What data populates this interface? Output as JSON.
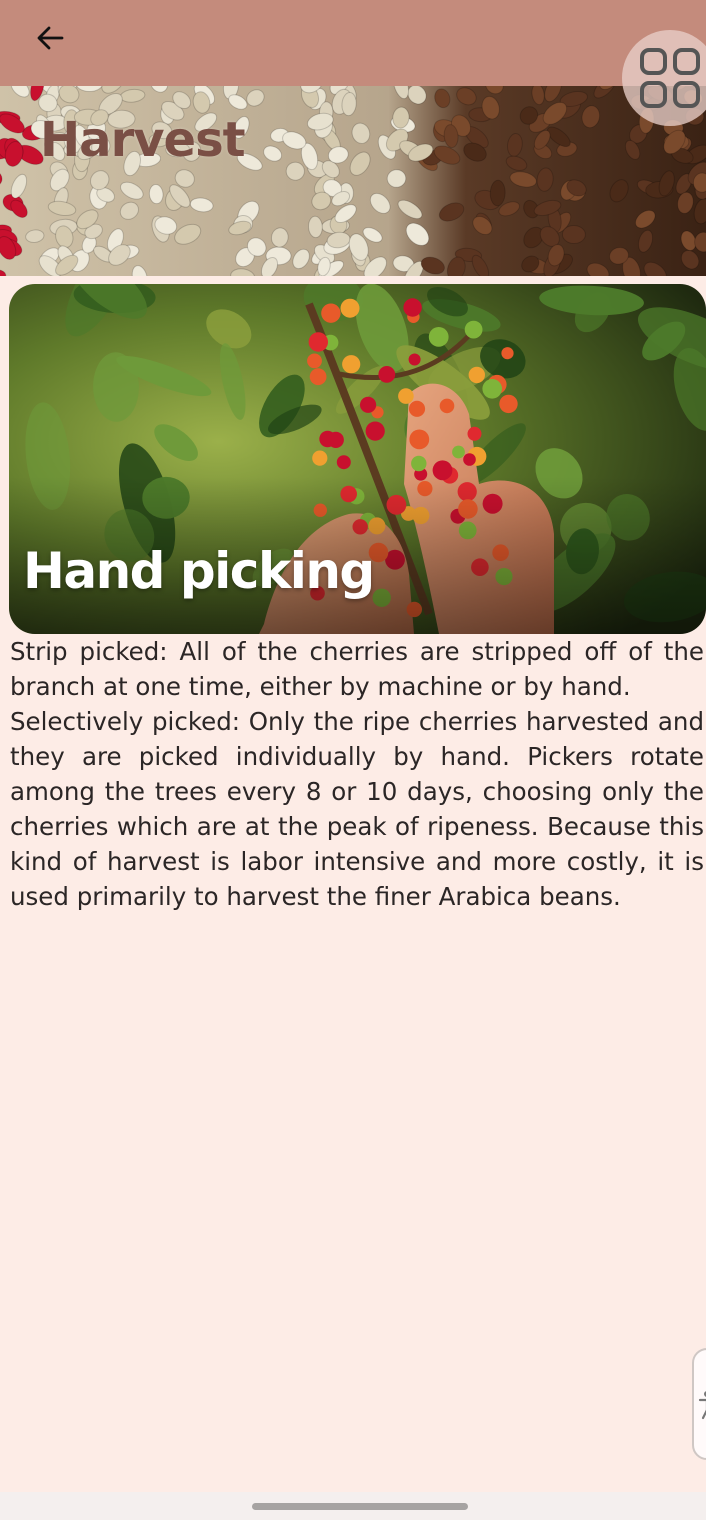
{
  "header": {
    "back_icon": "arrow-left-icon",
    "title": "Harvest",
    "menu_icon": "grid-icon"
  },
  "card": {
    "caption": "Hand picking"
  },
  "content": {
    "text": "Strip picked: All of the cherries are stripped off of the branch at one time, either by machine or by hand.\nSelectively picked: Only the ripe cherries harvested and they are picked individually by hand. Pickers rotate among the trees every 8 or 10 days, choosing only the cherries which are at the peak of ripeness. Because this kind of harvest is labor intensive and more costly, it is used primarily to harvest the finer Arabica beans."
  },
  "colors": {
    "appbar": "#c48b7c",
    "background": "#fdece6",
    "title": "#7a4f45"
  }
}
